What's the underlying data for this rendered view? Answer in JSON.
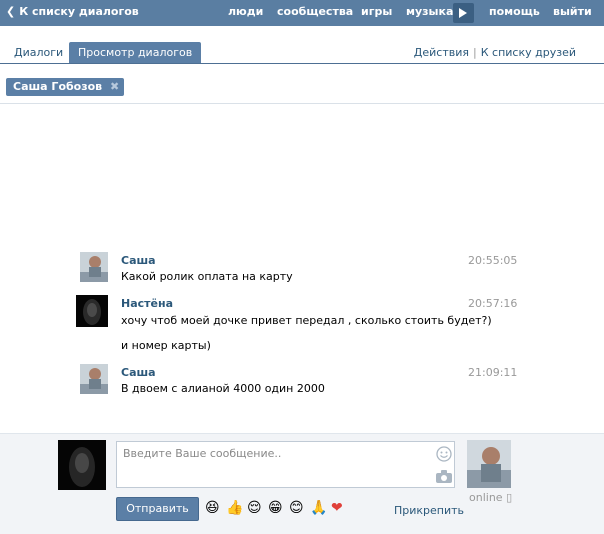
{
  "topbar": {
    "back_label": "К списку диалогов",
    "nav": [
      "люди",
      "сообщества",
      "игры",
      "музыка",
      "помощь",
      "выйти"
    ]
  },
  "tabs": {
    "items": [
      "Диалоги",
      "Просмотр диалогов"
    ],
    "actions": [
      "Действия",
      "К списку друзей"
    ]
  },
  "chip": {
    "label": "Саша Гобозов"
  },
  "messages": [
    {
      "name": "Саша",
      "lines": [
        "Какой ролик оплата на карту"
      ],
      "time": "20:55:05"
    },
    {
      "name": "Настёна",
      "lines": [
        "хочу чтоб моей дочке привет передал , сколько стоить будет?)",
        "и номер карты)"
      ],
      "time": "20:57:16"
    },
    {
      "name": "Саша",
      "lines": [
        "В двоем с алианой 4000 один 2000"
      ],
      "time": "21:09:11"
    }
  ],
  "compose": {
    "placeholder": "Введите Ваше сообщение..",
    "send_label": "Отправить",
    "attach_label": "Прикрепить",
    "status": "online",
    "emoji": [
      "😆",
      "👍",
      "😌",
      "😁",
      "😊",
      "🙏",
      "❤"
    ]
  },
  "colors": {
    "topbar": "#5a7ea2",
    "accent": "#5b7fa6",
    "link": "#2b587a"
  }
}
